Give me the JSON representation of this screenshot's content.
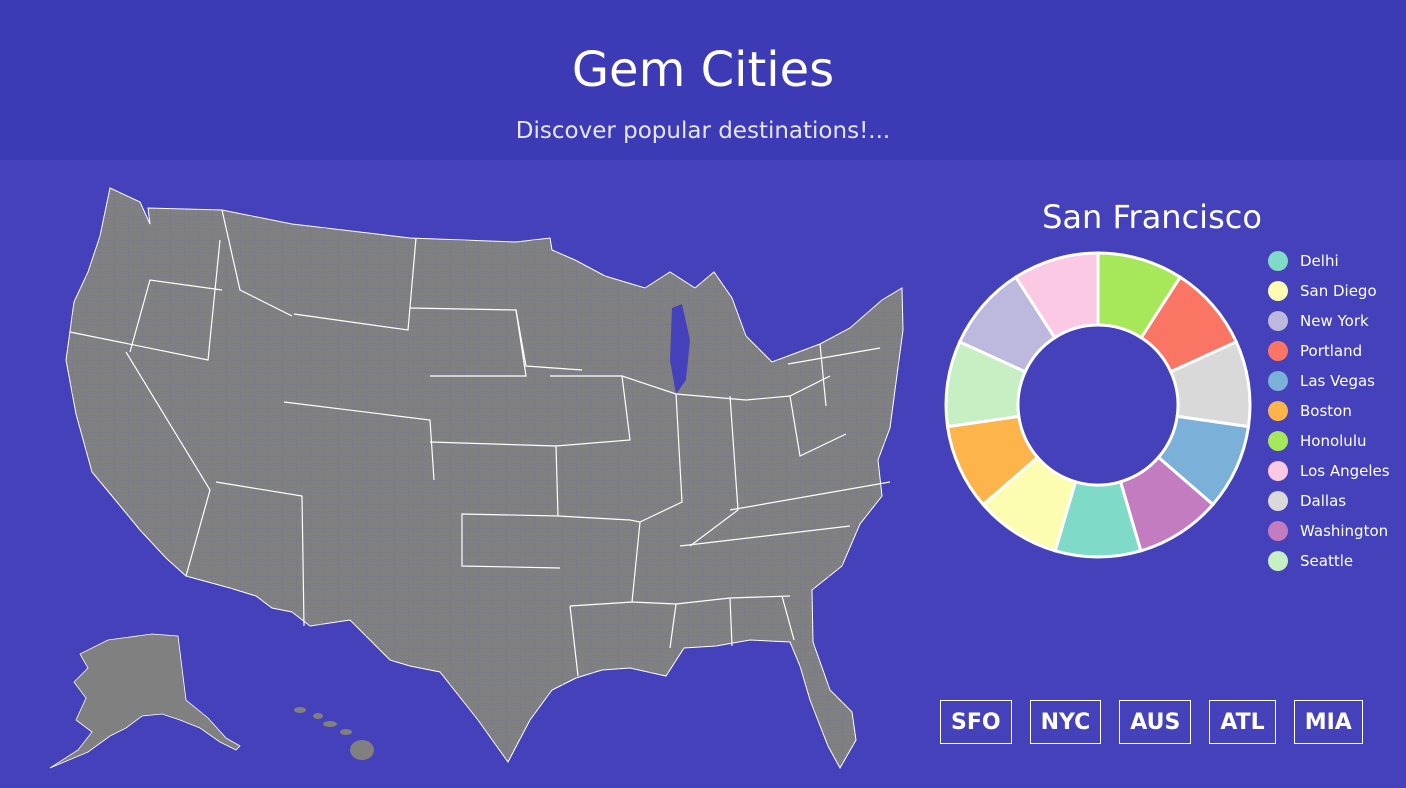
{
  "header": {
    "title": "Gem Cities",
    "subtitle": "Discover popular destinations!..."
  },
  "map": {
    "land_color": "#808080",
    "border_color": "#ffffff",
    "county_color": "#6e6e9c"
  },
  "chart_data": {
    "type": "pie",
    "subtype": "donut",
    "title": "San Francisco",
    "slices": [
      {
        "name": "Honolulu",
        "value": 1,
        "color": "#a6e85a"
      },
      {
        "name": "Portland",
        "value": 1,
        "color": "#fb7564"
      },
      {
        "name": "Dallas",
        "value": 1,
        "color": "#d9d9d9"
      },
      {
        "name": "Las Vegas",
        "value": 1,
        "color": "#7bb0d8"
      },
      {
        "name": "Washington",
        "value": 1,
        "color": "#c47cc0"
      },
      {
        "name": "Delhi",
        "value": 1,
        "color": "#7fdac8"
      },
      {
        "name": "San Diego",
        "value": 1,
        "color": "#fdfdb2"
      },
      {
        "name": "Boston",
        "value": 1,
        "color": "#fdb54b"
      },
      {
        "name": "Seattle",
        "value": 1,
        "color": "#c6efc4"
      },
      {
        "name": "New York",
        "value": 1,
        "color": "#bdb8dd"
      },
      {
        "name": "Los Angeles",
        "value": 1,
        "color": "#fcc9e4"
      }
    ],
    "legend": [
      {
        "label": "Delhi",
        "color": "#7fdac8"
      },
      {
        "label": "San Diego",
        "color": "#fdfdb2"
      },
      {
        "label": "New York",
        "color": "#bdb8dd"
      },
      {
        "label": "Portland",
        "color": "#fb7564"
      },
      {
        "label": "Las Vegas",
        "color": "#7bb0d8"
      },
      {
        "label": "Boston",
        "color": "#fdb54b"
      },
      {
        "label": "Honolulu",
        "color": "#a6e85a"
      },
      {
        "label": "Los Angeles",
        "color": "#fcc9e4"
      },
      {
        "label": "Dallas",
        "color": "#d9d9d9"
      },
      {
        "label": "Washington",
        "color": "#c47cc0"
      },
      {
        "label": "Seattle",
        "color": "#c6efc4"
      }
    ],
    "legend_position": "right"
  },
  "buttons": [
    "SFO",
    "NYC",
    "AUS",
    "ATL",
    "MIA"
  ]
}
